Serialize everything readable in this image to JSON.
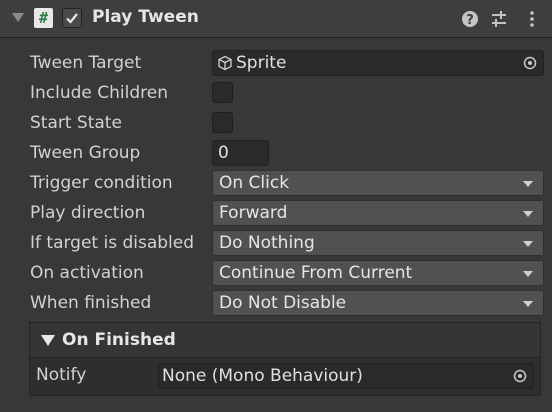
{
  "component": {
    "title": "Play Tween",
    "script_icon": "#",
    "enabled": true,
    "icons": [
      "help-icon",
      "presets-icon",
      "menu-icon"
    ]
  },
  "fields": {
    "tween_target": {
      "label": "Tween Target",
      "value": "Sprite"
    },
    "include_children": {
      "label": "Include Children",
      "checked": false
    },
    "start_state": {
      "label": "Start State",
      "checked": false
    },
    "tween_group": {
      "label": "Tween Group",
      "value": "0"
    },
    "trigger_condition": {
      "label": "Trigger condition",
      "value": "On Click"
    },
    "play_direction": {
      "label": "Play direction",
      "value": "Forward"
    },
    "if_target_disabled": {
      "label": "If target is disabled",
      "value": "Do Nothing"
    },
    "on_activation": {
      "label": "On activation",
      "value": "Continue From Current"
    },
    "when_finished": {
      "label": "When finished",
      "value": "Do Not Disable"
    }
  },
  "on_finished": {
    "title": "On Finished",
    "notify_label": "Notify",
    "notify_value": "None (Mono Behaviour)"
  },
  "colors": {
    "background": "#383838",
    "header": "#3e3e3e",
    "field_bg": "#2a2a2a",
    "dropdown_bg": "#515151"
  }
}
